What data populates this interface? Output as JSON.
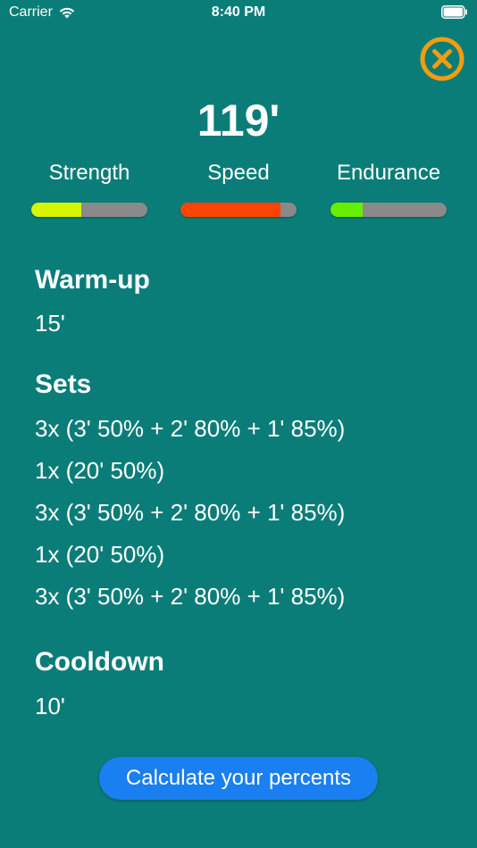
{
  "status_bar": {
    "carrier": "Carrier",
    "time": "8:40 PM"
  },
  "workout": {
    "total_time": "119'"
  },
  "metrics": [
    {
      "label": "Strength",
      "level": 0.43,
      "color": "#d6f500"
    },
    {
      "label": "Speed",
      "level": 0.86,
      "color": "#fa4400"
    },
    {
      "label": "Endurance",
      "level": 0.28,
      "color": "#66ee00"
    }
  ],
  "warmup": {
    "title": "Warm-up",
    "value": "15'"
  },
  "sets": {
    "title": "Sets",
    "items": [
      "3x (3' 50% + 2' 80% + 1' 85%)",
      "1x (20' 50%)",
      "3x (3' 50% + 2' 80% + 1' 85%)",
      "1x (20' 50%)",
      "3x (3' 50% + 2' 80% + 1' 85%)"
    ]
  },
  "cooldown": {
    "title": "Cooldown",
    "value": "10'"
  },
  "actions": {
    "calculate_label": "Calculate your percents"
  },
  "colors": {
    "background": "#0b7d79",
    "close_icon": "#f39c12",
    "button": "#1a7ff0",
    "bar_track": "#8a8a8a"
  },
  "icons": {
    "close": "close-circle-icon",
    "wifi": "wifi-icon",
    "battery": "battery-icon"
  }
}
